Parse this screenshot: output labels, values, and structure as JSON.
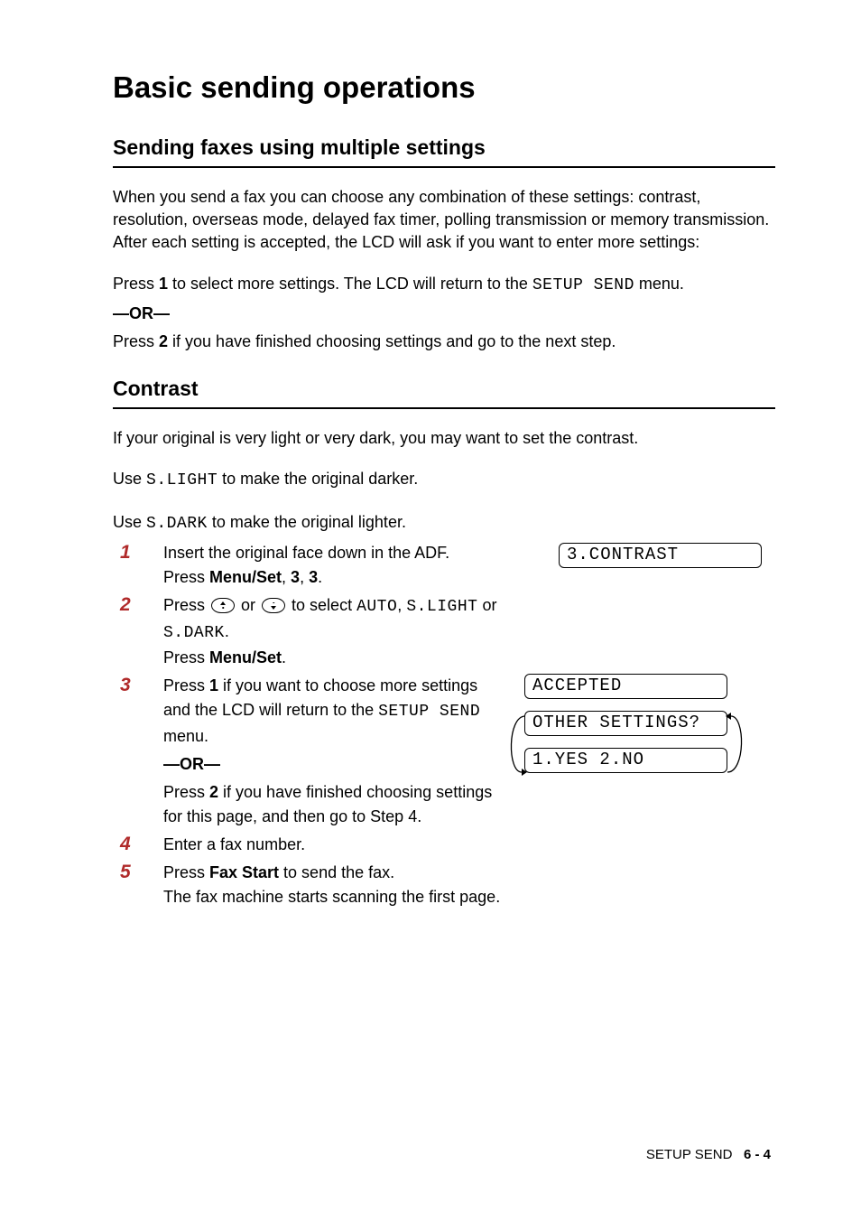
{
  "h1": "Basic sending operations",
  "sec1": {
    "title": "Sending faxes using multiple settings",
    "p1": "When you send a fax you can choose any combination of these settings: contrast, resolution, overseas mode, delayed fax timer, polling transmission or memory transmission. After each setting is accepted, the LCD will ask if you want to enter more settings:",
    "p2_pre": "Press ",
    "p2_key": "1",
    "p2_mid": " to select more settings. The LCD will return to the ",
    "p2_mono": "SETUP SEND",
    "p2_post": " menu.",
    "or": "—OR—",
    "p3_pre": "Press ",
    "p3_key": "2",
    "p3_post": " if you have finished choosing settings and go to the next step."
  },
  "sec2": {
    "title": "Contrast",
    "p1": "If your original is very light or very dark, you may want to set the contrast.",
    "p2_pre": "Use ",
    "p2_mono": "S.LIGHT",
    "p2_post": " to make the original darker.",
    "p3_pre": "Use ",
    "p3_mono": "S.DARK",
    "p3_post": " to make the original lighter.",
    "steps": {
      "s1": {
        "num": "1",
        "l1": "Insert the original face down in the ADF.",
        "l2_pre": "Press ",
        "l2_key": "Menu/Set",
        "l2_post": ", ",
        "l2_k2": "3",
        "l2_post2": ", ",
        "l2_k3": "3",
        "l2_end": "."
      },
      "s2": {
        "num": "2",
        "l1_pre": "Press ",
        "l1_mid": " or ",
        "l1_post": " to select ",
        "l1_m1": "AUTO",
        "l1_c1": ", ",
        "l1_m2": "S.LIGHT",
        "l1_c2": " or ",
        "l1_m3": "S.DARK",
        "l1_end": ".",
        "l2_pre": "Press ",
        "l2_key": "Menu/Set",
        "l2_end": "."
      },
      "s3": {
        "num": "3",
        "l1_pre": "Press ",
        "l1_key": "1",
        "l1_mid": " if you want to choose more settings and the LCD will return to the ",
        "l1_mono": "SETUP SEND",
        "l1_post": " menu.",
        "or": "—OR—",
        "l2_pre": "Press ",
        "l2_key": "2",
        "l2_post": " if you have finished choosing settings for this page, and then go to Step 4."
      },
      "s4": {
        "num": "4",
        "l1": "Enter a fax number."
      },
      "s5": {
        "num": "5",
        "l1_pre": "Press ",
        "l1_key": "Fax Start",
        "l1_post": " to send the fax.",
        "l2": "The fax machine starts scanning the first page."
      }
    },
    "lcd": {
      "d1": "3.CONTRAST",
      "d2": "ACCEPTED",
      "d3": "OTHER SETTINGS?",
      "d4": "1.YES 2.NO"
    }
  },
  "footer": {
    "label": "SETUP SEND",
    "page": "6 - 4"
  }
}
